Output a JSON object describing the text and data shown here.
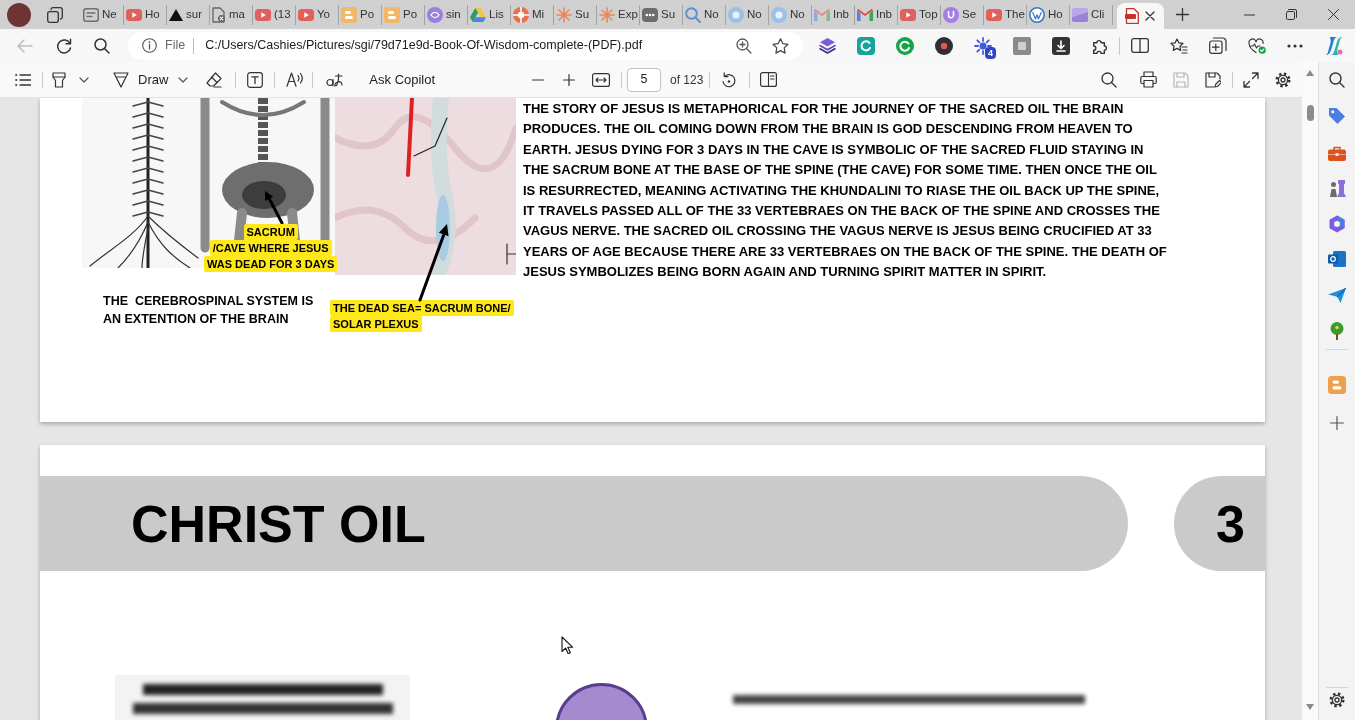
{
  "tab_strip": {
    "tabs": [
      {
        "label": "Ne",
        "selected": false
      },
      {
        "label": "Ho",
        "selected": false
      },
      {
        "label": "sur",
        "selected": false
      },
      {
        "label": "ma",
        "selected": false
      },
      {
        "label": "(13",
        "selected": false
      },
      {
        "label": "Yo",
        "selected": false
      },
      {
        "label": "Po",
        "selected": false
      },
      {
        "label": "Po",
        "selected": false
      },
      {
        "label": "sin",
        "selected": false
      },
      {
        "label": "Lis",
        "selected": false
      },
      {
        "label": "Mi",
        "selected": false
      },
      {
        "label": "Su",
        "selected": false
      },
      {
        "label": "Exp",
        "selected": false
      },
      {
        "label": "Su",
        "selected": false
      },
      {
        "label": "No",
        "selected": false
      },
      {
        "label": "No",
        "selected": false
      },
      {
        "label": "No",
        "selected": false
      },
      {
        "label": "Inb",
        "selected": false
      },
      {
        "label": "Inb",
        "selected": false
      },
      {
        "label": "Top",
        "selected": false
      },
      {
        "label": "Se",
        "selected": false
      },
      {
        "label": "The",
        "selected": false
      },
      {
        "label": "Ho",
        "selected": false
      },
      {
        "label": "Cli",
        "selected": false
      },
      {
        "selected": true
      }
    ]
  },
  "address_bar": {
    "back_disabled": true,
    "scheme": "File",
    "url": "C:/Users/Cashies/Pictures/sgi/79d71e9d-Book-Of-Wisdom-complete-(PDF).pdf",
    "extension_badge": "4"
  },
  "pdf_toolbar": {
    "draw_label": "Draw",
    "copilot_label": "Ask Copilot",
    "page_number": "5",
    "page_count": "of 123",
    "save_disabled": true
  },
  "page_1": {
    "image_callout": {
      "lines": [
        "SACRUM",
        "/CAVE WHERE JESUS",
        "WAS DEAD FOR 3 DAYS"
      ]
    },
    "caption": "THE  CEREBROSPINAL SYSTEM IS AN EXTENTION OF THE BRAIN",
    "map_callout": {
      "lines": [
        "THE DEAD SEA= SACRUM BONE/",
        "SOLAR PLEXUS"
      ]
    },
    "paragraph": "THE STORY OF JESUS IS METAPHORICAL FOR THE JOURNEY OF THE SACRED OIL THE BRAIN PRODUCES. THE OIL COMING DOWN FROM THE BRAIN IS GOD DESCENDING FROM HEAVEN TO EARTH. JESUS DYING FOR 3 DAYS IN THE CAVE IS SYMBOLIC OF THE SACRED FLUID STAYING IN THE SACRUM BONE AT THE BASE OF THE SPINE (THE CAVE) FOR SOME TIME. THEN ONCE THE OIL IS RESURRECTED, MEANING ACTIVATING THE KHUNDALINI TO RIASE THE OIL BACK UP THE SPINE, IT TRAVELS PASSED ALL OF THE 33 VERTEBRAES ON THE BACK OF THE SPINE AND CROSSES THE VAGUS NERVE. THE SACRED OIL CROSSING THE VAGUS NERVE IS JESUS BEING CRUCIFIED AT 33 YEARS OF AGE BECAUSE THERE ARE 33 VERTEBRAES ON THE BACK OF THE SPINE. THE DEATH OF JESUS SYMBOLIZES BEING BORN AGAIN AND TURNING SPIRIT MATTER IN SPIRIT."
  },
  "page_2": {
    "heading": "CHRIST OIL",
    "chapter_number": "3"
  }
}
